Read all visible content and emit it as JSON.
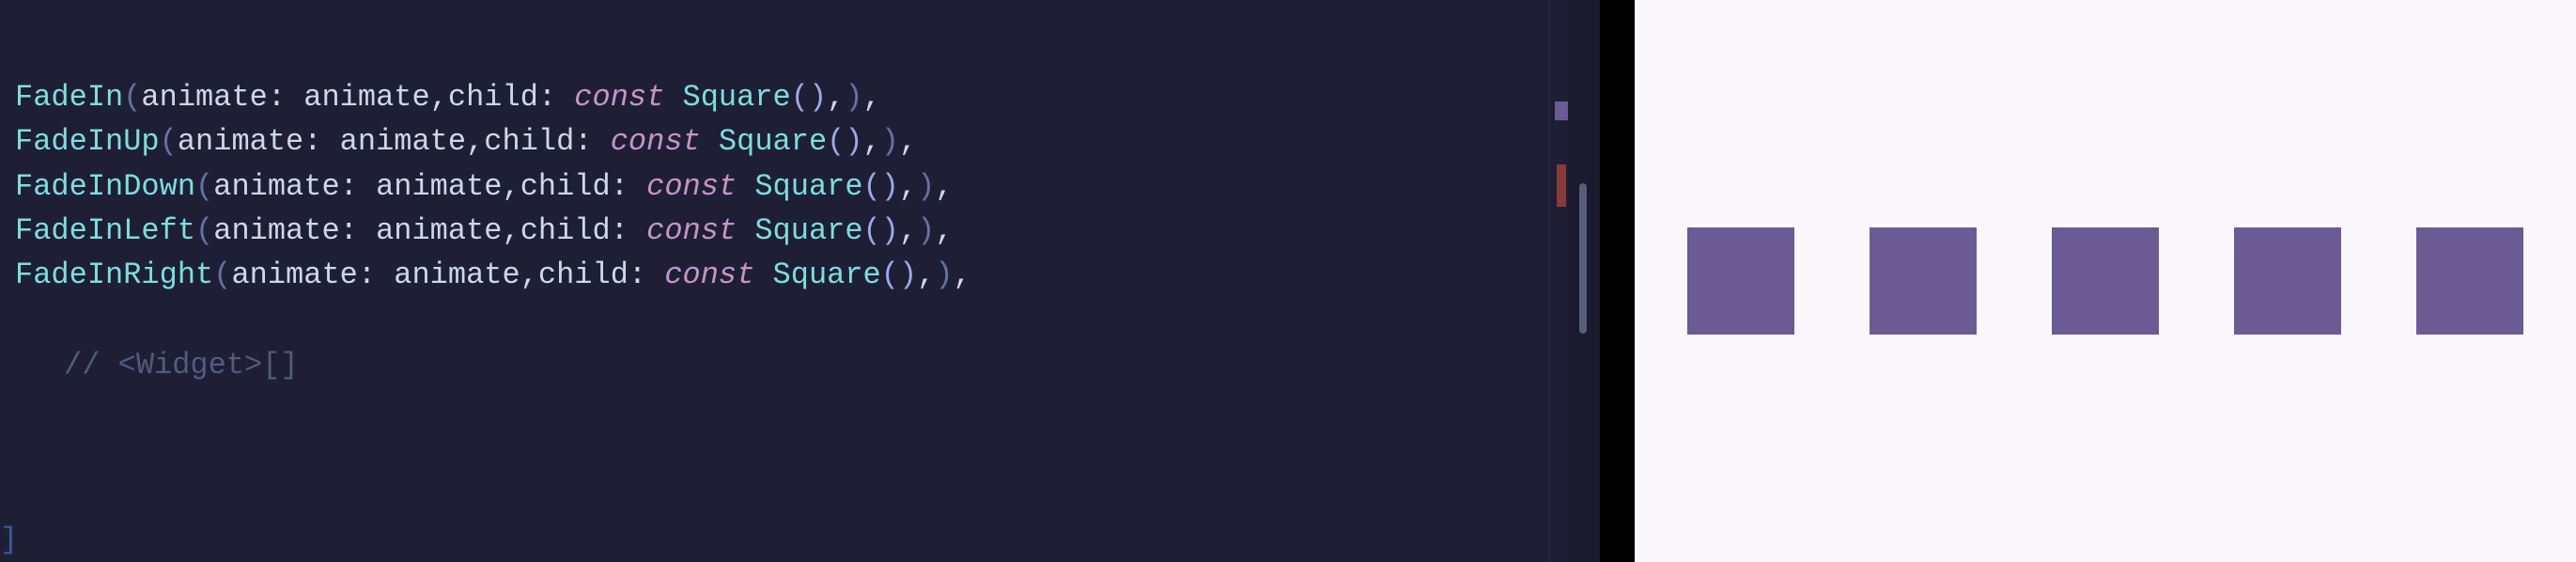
{
  "code": {
    "lines": [
      {
        "class_name": "FadeIn",
        "param1": "animate",
        "arg1": "animate",
        "param2": "child",
        "keyword": "const",
        "type": "Square"
      },
      {
        "class_name": "FadeInUp",
        "param1": "animate",
        "arg1": "animate",
        "param2": "child",
        "keyword": "const",
        "type": "Square"
      },
      {
        "class_name": "FadeInDown",
        "param1": "animate",
        "arg1": "animate",
        "param2": "child",
        "keyword": "const",
        "type": "Square"
      },
      {
        "class_name": "FadeInLeft",
        "param1": "animate",
        "arg1": "animate",
        "param2": "child",
        "keyword": "const",
        "type": "Square"
      },
      {
        "class_name": "FadeInRight",
        "param1": "animate",
        "arg1": "animate",
        "param2": "child",
        "keyword": "const",
        "type": "Square"
      }
    ],
    "comment": "// <Widget>[]"
  },
  "preview": {
    "squares_count": 5,
    "square_color": "#6b5b95",
    "background_color": "#faf7fc"
  },
  "punctuation": {
    "open_paren": "(",
    "close_paren": ")",
    "colon": ":",
    "comma": ",",
    "space": " ",
    "bracket": "]"
  }
}
